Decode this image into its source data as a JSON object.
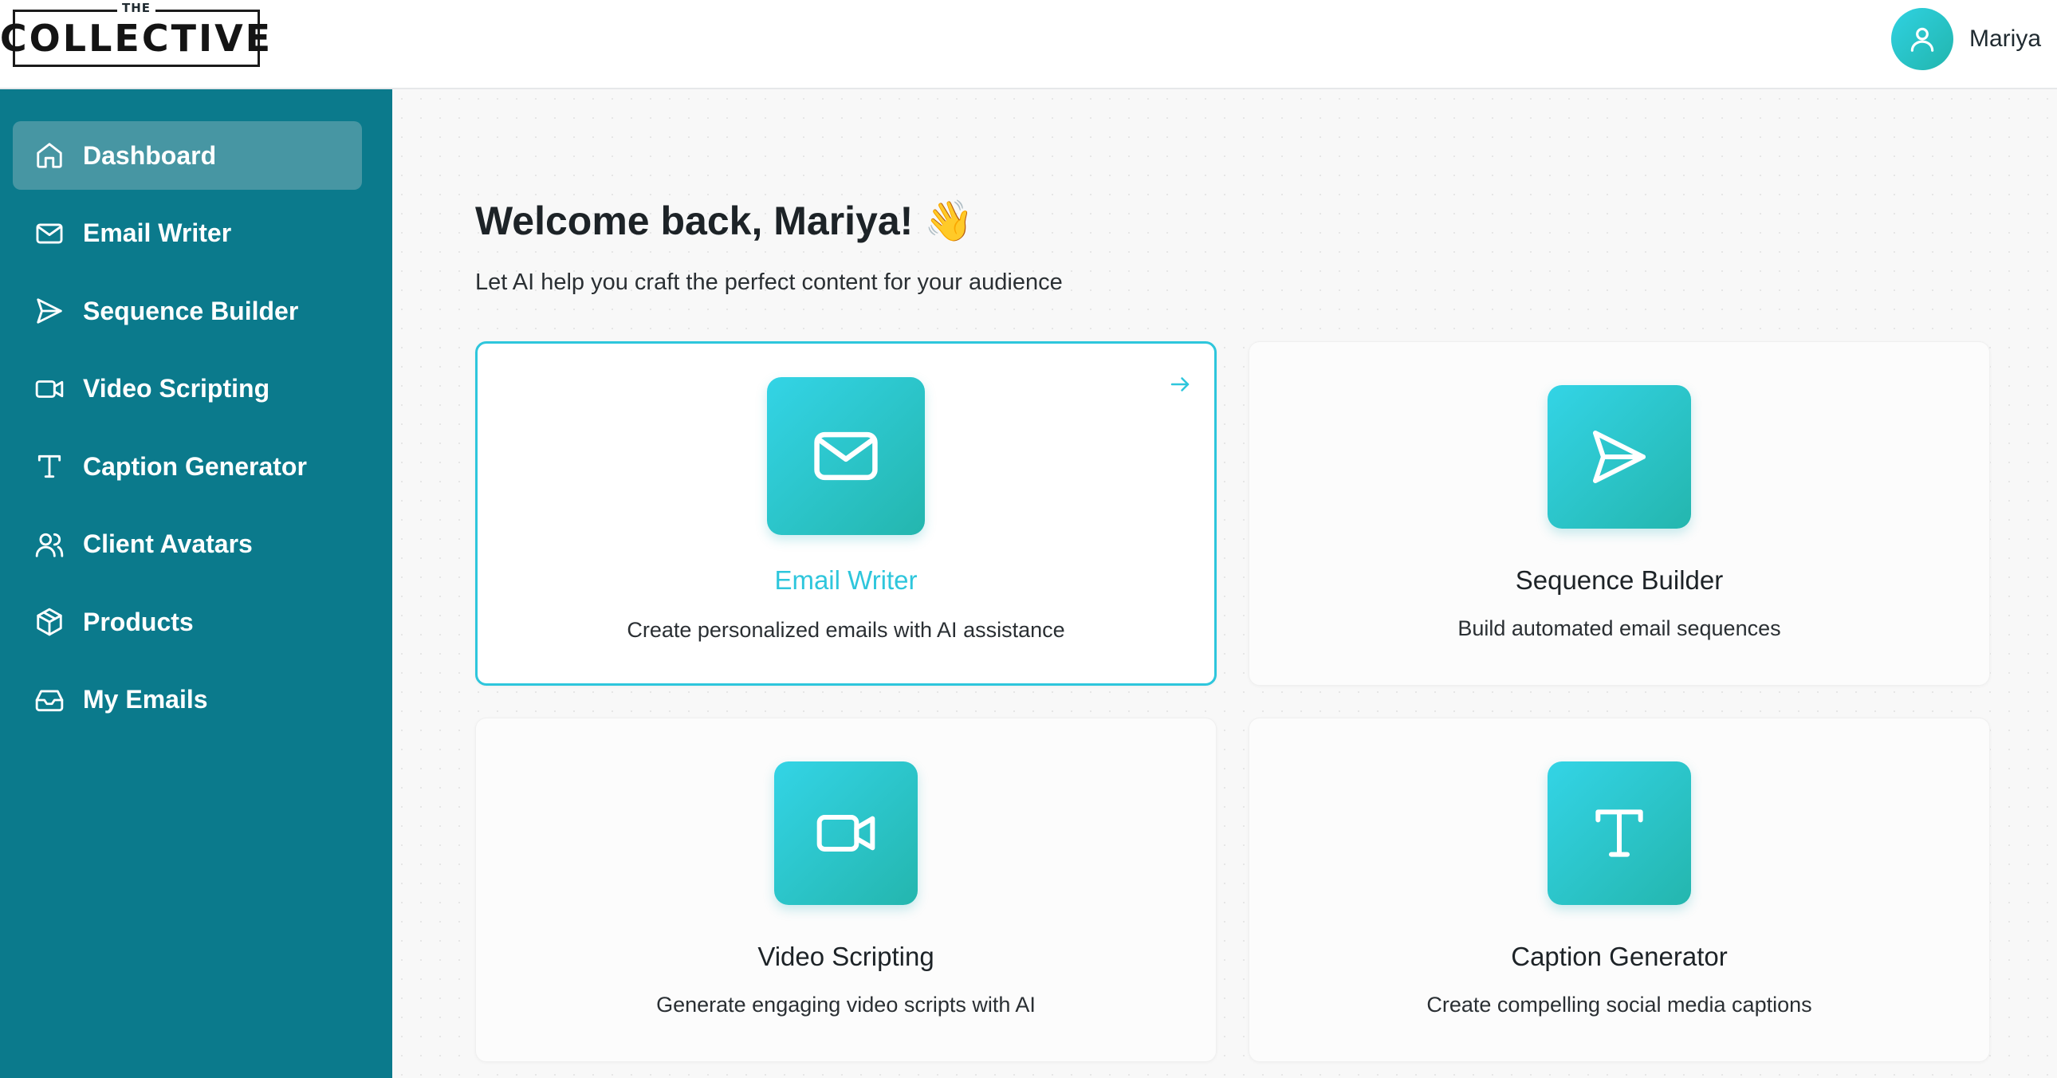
{
  "header": {
    "logo_small": "THE",
    "logo_main": "COLLECTIVE",
    "user_name": "Mariya"
  },
  "sidebar": {
    "items": [
      {
        "label": "Dashboard",
        "icon": "home-icon",
        "active": true
      },
      {
        "label": "Email Writer",
        "icon": "mail-icon",
        "active": false
      },
      {
        "label": "Sequence Builder",
        "icon": "send-icon",
        "active": false
      },
      {
        "label": "Video Scripting",
        "icon": "video-icon",
        "active": false
      },
      {
        "label": "Caption Generator",
        "icon": "type-icon",
        "active": false
      },
      {
        "label": "Client Avatars",
        "icon": "users-icon",
        "active": false
      },
      {
        "label": "Products",
        "icon": "package-icon",
        "active": false
      },
      {
        "label": "My Emails",
        "icon": "inbox-icon",
        "active": false
      }
    ]
  },
  "main": {
    "welcome": "Welcome back, Mariya! 👋",
    "subtitle": "Let AI help you craft the perfect content for your audience",
    "cards": [
      {
        "title": "Email Writer",
        "description": "Create personalized emails with AI assistance",
        "icon": "mail-icon",
        "selected": true
      },
      {
        "title": "Sequence Builder",
        "description": "Build automated email sequences",
        "icon": "send-icon",
        "selected": false
      },
      {
        "title": "Video Scripting",
        "description": "Generate engaging video scripts with AI",
        "icon": "video-icon",
        "selected": false
      },
      {
        "title": "Caption Generator",
        "description": "Create compelling social media captions",
        "icon": "type-icon",
        "selected": false
      }
    ]
  },
  "colors": {
    "sidebar": "#0b7a8c",
    "sidebar_active": "#4796a3",
    "accent": "#2ec6dc",
    "icon_gradient_start": "#33d4e6",
    "icon_gradient_end": "#24b6ae"
  }
}
